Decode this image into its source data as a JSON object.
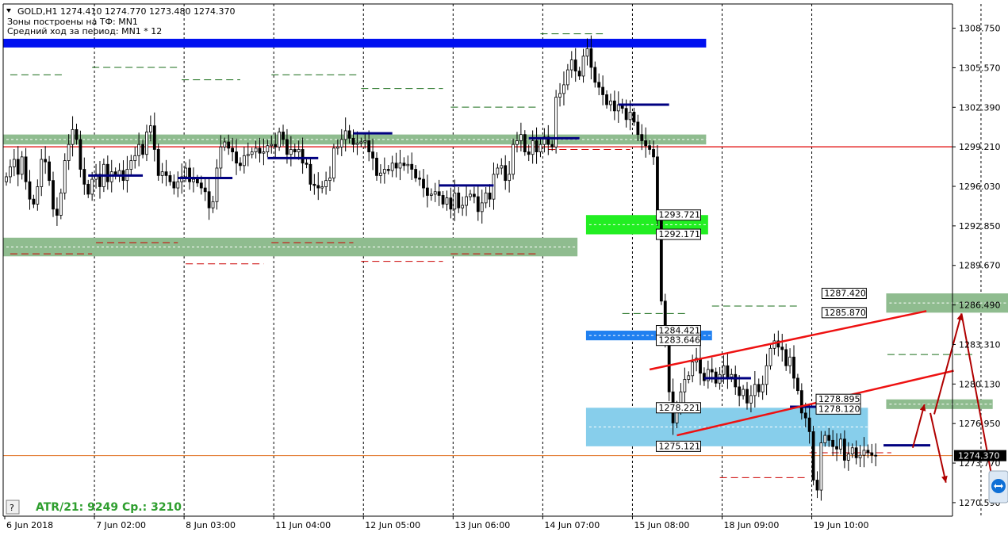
{
  "header": {
    "symbol_line": "GOLD,H1  1274.410 1274.770 1273.480 1274.370",
    "zones_line": "Зоны построены на ТФ: MN1",
    "avg_line": "Средний ход за период: MN1 * 12"
  },
  "footer": {
    "help_button": "?",
    "atr_text": "ATR/21: 9249  Cp.: 3210"
  },
  "colors": {
    "candle": "#000000",
    "blue_zone": "#0010f0",
    "green_zone": "#8fbc8f",
    "bright_green_zone": "#22ee22",
    "light_blue_zone": "#87ceeb",
    "mid_blue_zone": "#2080f0",
    "red_line": "#e00000",
    "orange_line": "#e07020",
    "navy_level": "#000080",
    "arrow": "#b00000",
    "channel": "#ee1111"
  },
  "chart_data": {
    "type": "candlestick",
    "symbol": "GOLD",
    "timeframe": "H1",
    "ohlc_current": {
      "open": 1274.41,
      "high": 1274.77,
      "low": 1273.48,
      "close": 1274.37
    },
    "y_ticks": [
      1308.75,
      1305.57,
      1302.39,
      1299.21,
      1296.03,
      1292.85,
      1289.67,
      1286.49,
      1283.31,
      1280.13,
      1276.95,
      1273.77,
      1270.59
    ],
    "y_range": [
      1269.5,
      1310.7
    ],
    "x_labels": [
      "6 Jun 2018",
      "7 Jun 02:00",
      "8 Jun 03:00",
      "11 Jun 04:00",
      "12 Jun 05:00",
      "13 Jun 06:00",
      "14 Jun 07:00",
      "15 Jun 08:00",
      "18 Jun 09:00",
      "19 Jun 10:00"
    ],
    "x_label_positions": [
      0,
      23,
      46,
      69,
      92,
      115,
      138,
      161,
      184,
      207
    ],
    "total_bars": 244,
    "current_price": 1274.37,
    "red_level": 1299.21,
    "closes": [
      1296.8,
      1297.6,
      1298.2,
      1297.0,
      1298.4,
      1296.4,
      1295.0,
      1294.6,
      1296.0,
      1298.2,
      1298.0,
      1296.5,
      1294.2,
      1293.7,
      1295.5,
      1298.1,
      1299.4,
      1300.6,
      1299.8,
      1297.4,
      1296.2,
      1295.4,
      1296.6,
      1297.0,
      1296.0,
      1297.8,
      1296.4,
      1297.2,
      1296.9,
      1297.3,
      1296.5,
      1297.4,
      1298.1,
      1298.5,
      1299.4,
      1298.6,
      1300.4,
      1300.9,
      1299.0,
      1296.9,
      1297.2,
      1296.9,
      1296.4,
      1295.9,
      1296.4,
      1296.8,
      1297.5,
      1296.4,
      1296.6,
      1296.3,
      1295.9,
      1295.6,
      1294.3,
      1294.8,
      1297.5,
      1299.2,
      1299.6,
      1299.1,
      1298.8,
      1297.9,
      1297.7,
      1298.5,
      1298.6,
      1298.8,
      1299.1,
      1298.7,
      1298.8,
      1299.3,
      1299.4,
      1299.2,
      1300.4,
      1299.8,
      1298.6,
      1299.0,
      1298.8,
      1299.0,
      1297.9,
      1297.8,
      1296.2,
      1296.1,
      1295.9,
      1296.0,
      1296.5,
      1296.7,
      1299.1,
      1299.2,
      1299.8,
      1300.5,
      1299.9,
      1299.4,
      1299.5,
      1299.6,
      1299.7,
      1298.8,
      1298.3,
      1296.9,
      1297.1,
      1297.4,
      1297.3,
      1297.9,
      1297.5,
      1297.9,
      1297.7,
      1297.8,
      1297.4,
      1296.7,
      1296.6,
      1295.9,
      1295.3,
      1295.4,
      1295.6,
      1295.3,
      1294.6,
      1295.1,
      1294.2,
      1295.5,
      1294.3,
      1294.5,
      1295.2,
      1295.4,
      1295.2,
      1294.0,
      1294.7,
      1295.5,
      1295.0,
      1297.0,
      1297.5,
      1297.7,
      1296.5,
      1297.0,
      1299.4,
      1299.7,
      1300.2,
      1298.8,
      1298.6,
      1299.7,
      1298.8,
      1299.4,
      1300.0,
      1299.4,
      1299.2,
      1303.2,
      1303.5,
      1304.2,
      1305.4,
      1306.2,
      1305.3,
      1304.9,
      1306.5,
      1307.1,
      1305.6,
      1304.4,
      1304.0,
      1303.4,
      1302.6,
      1302.9,
      1302.1,
      1302.6,
      1302.3,
      1301.4,
      1302.0,
      1301.2,
      1300.2,
      1299.7,
      1299.3,
      1299.0,
      1298.4,
      1293.7,
      1286.8,
      1283.6,
      1279.5,
      1277.0,
      1278.3,
      1279.5,
      1280.5,
      1280.8,
      1281.9,
      1282.2,
      1281.0,
      1280.4,
      1281.3,
      1281.1,
      1280.2,
      1280.9,
      1281.6,
      1280.7,
      1280.9,
      1279.9,
      1279.2,
      1279.7,
      1278.6,
      1279.2,
      1280.1,
      1279.5,
      1280.1,
      1281.6,
      1283.0,
      1283.6,
      1283.1,
      1282.9,
      1281.6,
      1282.3,
      1280.6,
      1279.6,
      1277.8,
      1277.4,
      1276.3,
      1272.4,
      1271.6,
      1275.4,
      1276.0,
      1275.6,
      1275.1,
      1274.9,
      1275.7,
      1274.0,
      1274.5,
      1275.0,
      1274.2,
      1274.4,
      1274.8,
      1274.6,
      1274.4,
      1274.37
    ],
    "price_labels": [
      {
        "text": "1293.721",
        "bar": 178.5,
        "price": 1293.721
      },
      {
        "text": "1292.171",
        "bar": 178.5,
        "price": 1292.171
      },
      {
        "text": "1284.421",
        "bar": 178.5,
        "price": 1284.421
      },
      {
        "text": "1283.646",
        "bar": 178.5,
        "price": 1283.646
      },
      {
        "text": "1278.221",
        "bar": 178.5,
        "price": 1278.221
      },
      {
        "text": "1275.121",
        "bar": 178.5,
        "price": 1275.121
      },
      {
        "text": "1287.420",
        "bar": 221,
        "price": 1287.42
      },
      {
        "text": "1285.870",
        "bar": 221,
        "price": 1285.87
      },
      {
        "text": "1278.895",
        "bar": 219.5,
        "price": 1278.895
      },
      {
        "text": "1278.120",
        "bar": 219.5,
        "price": 1278.12
      }
    ],
    "zones": [
      {
        "kind": "blue_zone",
        "bar_from": 0,
        "bar_to": 179.5,
        "high": 1307.9,
        "low": 1307.2
      },
      {
        "kind": "green_zone",
        "bar_from": 0,
        "bar_to": 179.5,
        "high": 1300.2,
        "low": 1299.4
      },
      {
        "kind": "green_zone",
        "bar_from": 0,
        "bar_to": 146.5,
        "high": 1291.9,
        "low": 1290.4
      },
      {
        "kind": "bright_green_zone",
        "bar_from": 149.5,
        "bar_to": 180,
        "high": 1293.721,
        "low": 1292.171
      },
      {
        "kind": "mid_blue_zone",
        "bar_from": 149.5,
        "bar_to": 181,
        "high": 1284.421,
        "low": 1283.646
      },
      {
        "kind": "light_blue_zone",
        "bar_from": 149.5,
        "bar_to": 221,
        "high": 1278.221,
        "low": 1275.121
      },
      {
        "kind": "green_zone",
        "bar_from": 226.5,
        "bar_to": 282,
        "high": 1287.42,
        "low": 1285.87
      },
      {
        "kind": "green_zone",
        "bar_from": 226.5,
        "bar_to": 253,
        "high": 1278.895,
        "low": 1278.12
      }
    ],
    "navy_levels": [
      {
        "bar_from": 21,
        "bar_to": 35,
        "price": 1296.9
      },
      {
        "bar_from": 44,
        "bar_to": 58,
        "price": 1296.7
      },
      {
        "bar_from": 67,
        "bar_to": 80,
        "price": 1298.3
      },
      {
        "bar_from": 89,
        "bar_to": 99,
        "price": 1300.3
      },
      {
        "bar_from": 111,
        "bar_to": 125,
        "price": 1296.1
      },
      {
        "bar_from": 134,
        "bar_to": 147,
        "price": 1299.9
      },
      {
        "bar_from": 157,
        "bar_to": 170,
        "price": 1302.6
      },
      {
        "bar_from": 179,
        "bar_to": 191,
        "price": 1280.6
      },
      {
        "bar_from": 201,
        "bar_to": 212,
        "price": 1278.3
      },
      {
        "bar_from": 225,
        "bar_to": 237,
        "price": 1275.2
      }
    ],
    "dashed_levels": [
      {
        "color": "#1a6e1a",
        "bar_from": 1,
        "bar_to": 15,
        "price": 1305.0
      },
      {
        "color": "#1a6e1a",
        "bar_from": 22,
        "bar_to": 44,
        "price": 1305.6
      },
      {
        "color": "#1a6e1a",
        "bar_from": 45,
        "bar_to": 60,
        "price": 1304.6
      },
      {
        "color": "#1a6e1a",
        "bar_from": 68,
        "bar_to": 90,
        "price": 1305.0
      },
      {
        "color": "#1a6e1a",
        "bar_from": 91,
        "bar_to": 112,
        "price": 1303.9
      },
      {
        "color": "#1a6e1a",
        "bar_from": 114,
        "bar_to": 136,
        "price": 1302.4
      },
      {
        "color": "#1a6e1a",
        "bar_from": 137,
        "bar_to": 153,
        "price": 1308.3
      },
      {
        "color": "#1a6e1a",
        "bar_from": 158,
        "bar_to": 175,
        "price": 1285.8
      },
      {
        "color": "#1a6e1a",
        "bar_from": 181,
        "bar_to": 203,
        "price": 1286.4
      },
      {
        "color": "#1a6e1a",
        "bar_from": 226,
        "bar_to": 248,
        "price": 1282.5
      },
      {
        "color": "#cc0000",
        "bar_from": 1,
        "bar_to": 22,
        "price": 1290.6
      },
      {
        "color": "#cc0000",
        "bar_from": 23,
        "bar_to": 44,
        "price": 1291.5
      },
      {
        "color": "#cc0000",
        "bar_from": 46,
        "bar_to": 66,
        "price": 1289.8
      },
      {
        "color": "#cc0000",
        "bar_from": 68,
        "bar_to": 89,
        "price": 1291.5
      },
      {
        "color": "#cc0000",
        "bar_from": 91,
        "bar_to": 112,
        "price": 1290.0
      },
      {
        "color": "#cc0000",
        "bar_from": 114,
        "bar_to": 136,
        "price": 1290.6
      },
      {
        "color": "#cc0000",
        "bar_from": 139,
        "bar_to": 160,
        "price": 1299.0
      },
      {
        "color": "#cc0000",
        "bar_from": 183,
        "bar_to": 205,
        "price": 1272.6
      },
      {
        "color": "#cc0000",
        "bar_from": 206,
        "bar_to": 227,
        "price": 1274.6
      }
    ],
    "channel_lines": [
      {
        "from": [
          165,
          1281.3
        ],
        "to": [
          236,
          1286.0
        ]
      },
      {
        "from": [
          172,
          1276.0
        ],
        "to": [
          243,
          1281.2
        ]
      }
    ],
    "arrows": [
      {
        "from": [
          232.5,
          1275.0
        ],
        "to": [
          235.5,
          1278.5
        ]
      },
      {
        "from": [
          237,
          1277.8
        ],
        "to": [
          241,
          1272.2
        ]
      },
      {
        "from": [
          238,
          1277.7
        ],
        "to": [
          245,
          1285.8
        ]
      },
      {
        "from": [
          245,
          1285.8
        ],
        "to": [
          254,
          1270.6
        ]
      }
    ]
  }
}
